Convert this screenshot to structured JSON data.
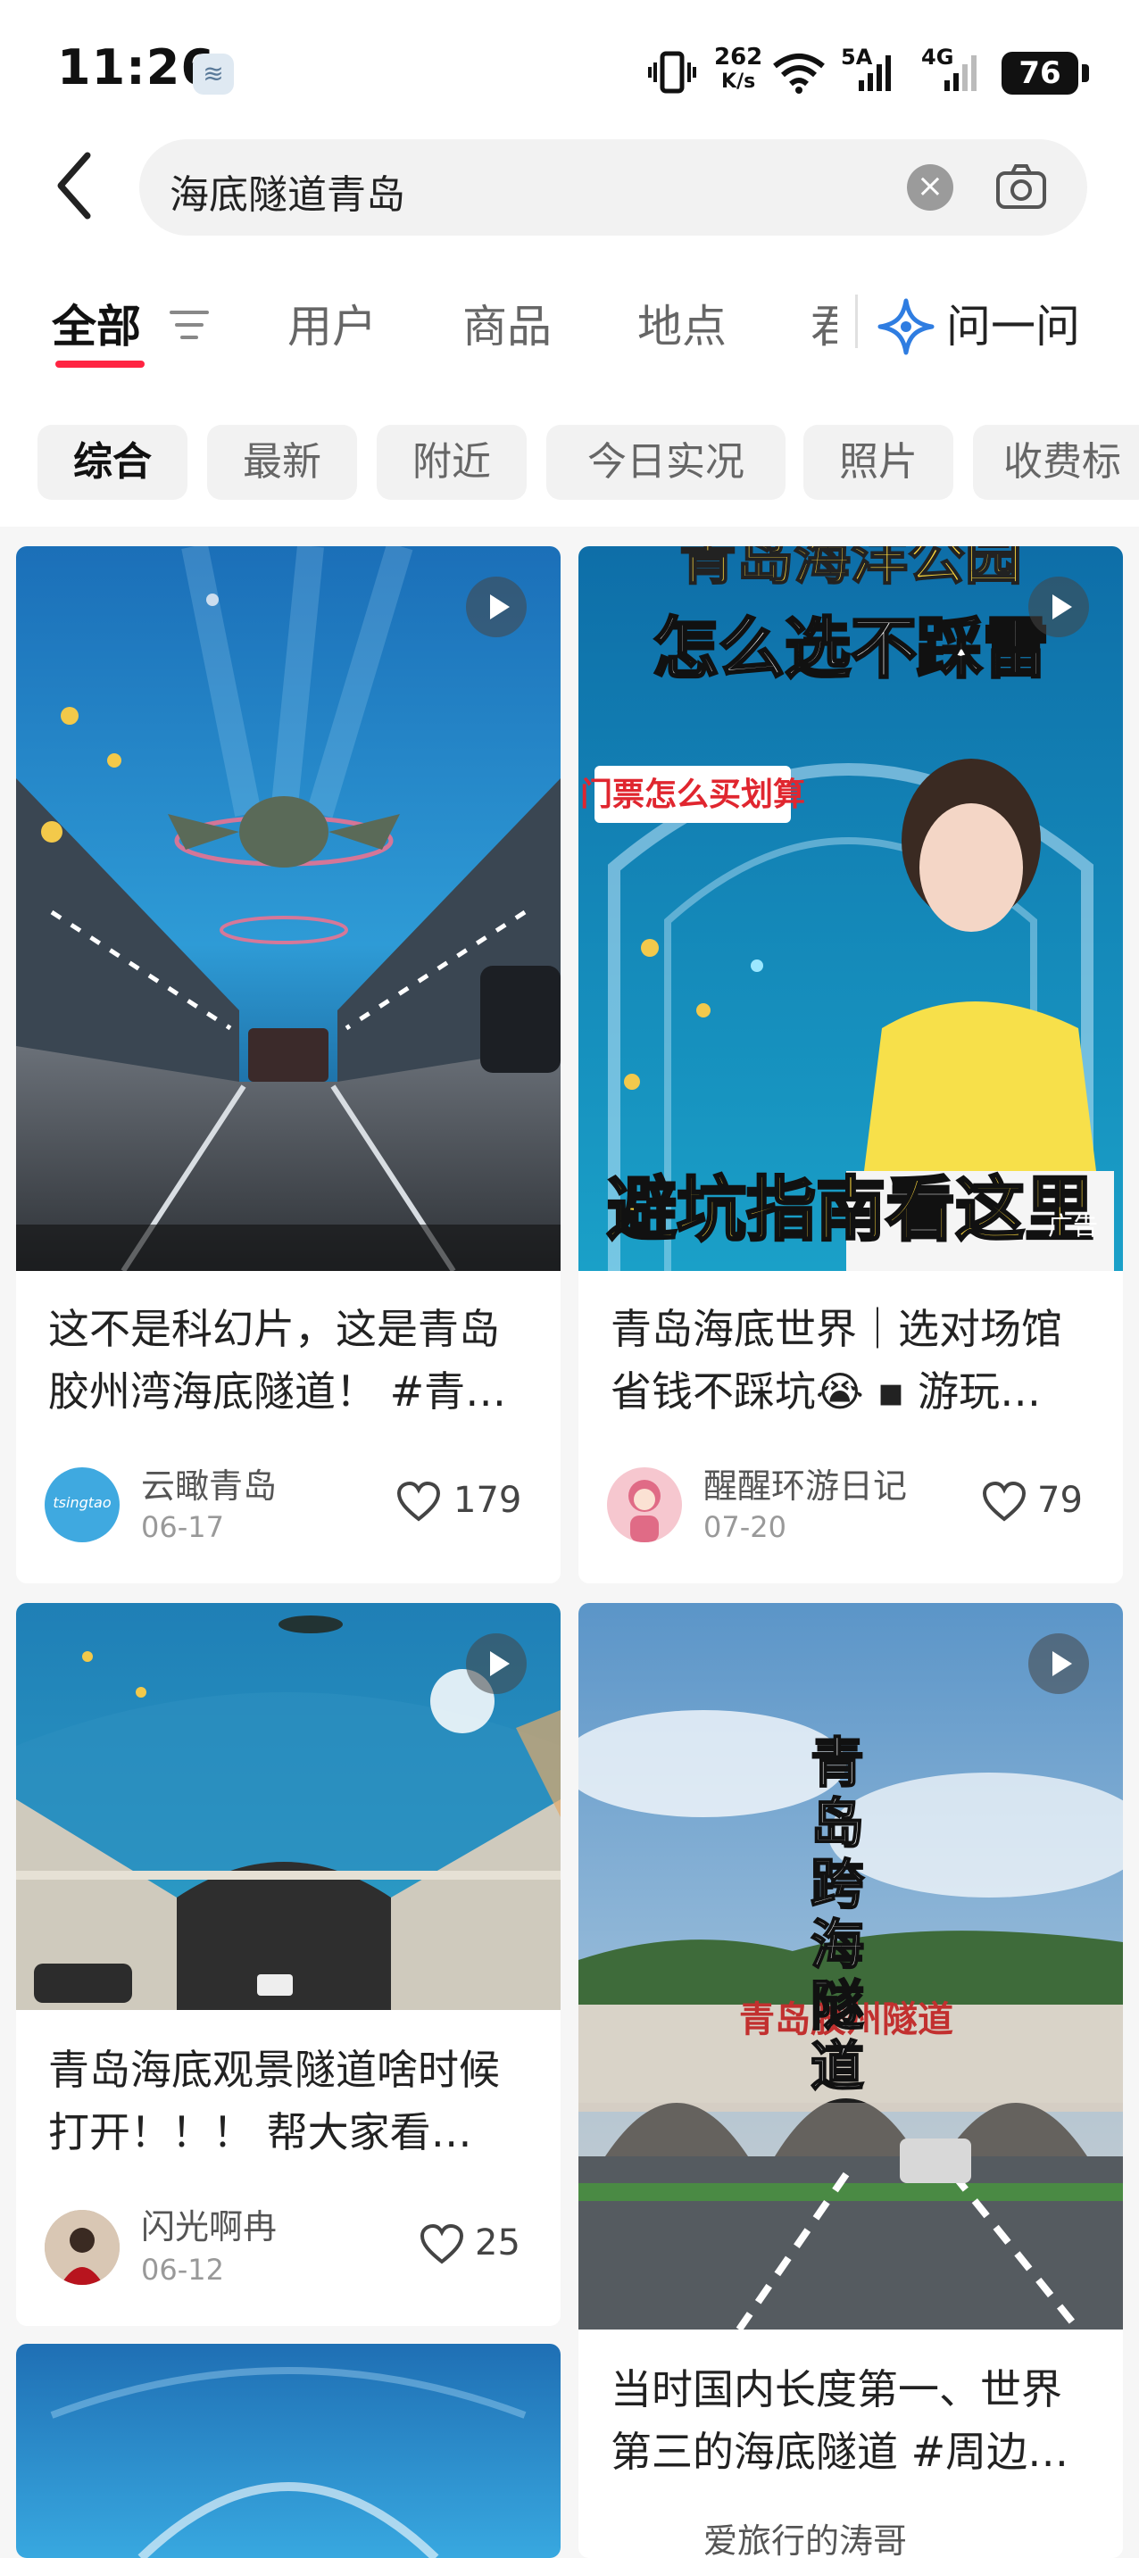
{
  "status_bar": {
    "time": "11:26",
    "speed_value": "262",
    "speed_unit": "K/s",
    "net_5g": "5A",
    "net_4g": "4G",
    "battery": "76"
  },
  "search": {
    "query": "海底隧道青岛"
  },
  "tabs": [
    {
      "label": "全部"
    },
    {
      "label": "用户"
    },
    {
      "label": "商品"
    },
    {
      "label": "地点"
    },
    {
      "label": "君"
    }
  ],
  "ask": {
    "label": "问一问"
  },
  "chips": [
    {
      "label": "综合"
    },
    {
      "label": "最新"
    },
    {
      "label": "附近"
    },
    {
      "label": "今日实况"
    },
    {
      "label": "照片"
    },
    {
      "label": "收费标"
    }
  ],
  "cards": [
    {
      "title": "这不是科幻片，这是青岛胶州湾海底隧道！ #青…",
      "title_line1": "这不是科幻片，这是青岛",
      "title_line2": "胶州湾海底隧道！ #青…",
      "author": "云瞰青岛",
      "date": "06-17",
      "likes": "179",
      "avatar_text": "tsingtao"
    },
    {
      "title": "青岛海底世界｜选对场馆省钱不踩坑😭 ▪ 游玩…",
      "title_line1": "青岛海底世界｜选对场馆",
      "title_line2": "省钱不踩坑😭 ▪ 游玩…",
      "author": "醒醒环游日记",
      "date": "07-20",
      "likes": "79",
      "overlay_top": "青岛海洋公园",
      "overlay_main": "怎么选不踩雷",
      "overlay_tag": "门票怎么买划算",
      "overlay_bottom": "避坑指南看这里",
      "ad_label": "广告"
    },
    {
      "title": "青岛海底观景隧道啥时候打开！！！ 帮大家看…",
      "title_line1": "青岛海底观景隧道啥时候",
      "title_line2": "打开！！！ 帮大家看…",
      "author": "闪光啊冉",
      "date": "06-12",
      "likes": "25"
    },
    {
      "title": "当时国内长度第一、世界第三的海底隧道 #周边…",
      "title_line1": "当时国内长度第一、世界",
      "title_line2": "第三的海底隧道 #周边…",
      "author": "爱旅行的涛哥",
      "overlay_vertical": "青岛跨海隧道",
      "overlay_sign": "青岛胶州隧道"
    },
    {}
  ],
  "colors": {
    "accent": "#ff2442",
    "ask_icon": "#2f7de1"
  }
}
